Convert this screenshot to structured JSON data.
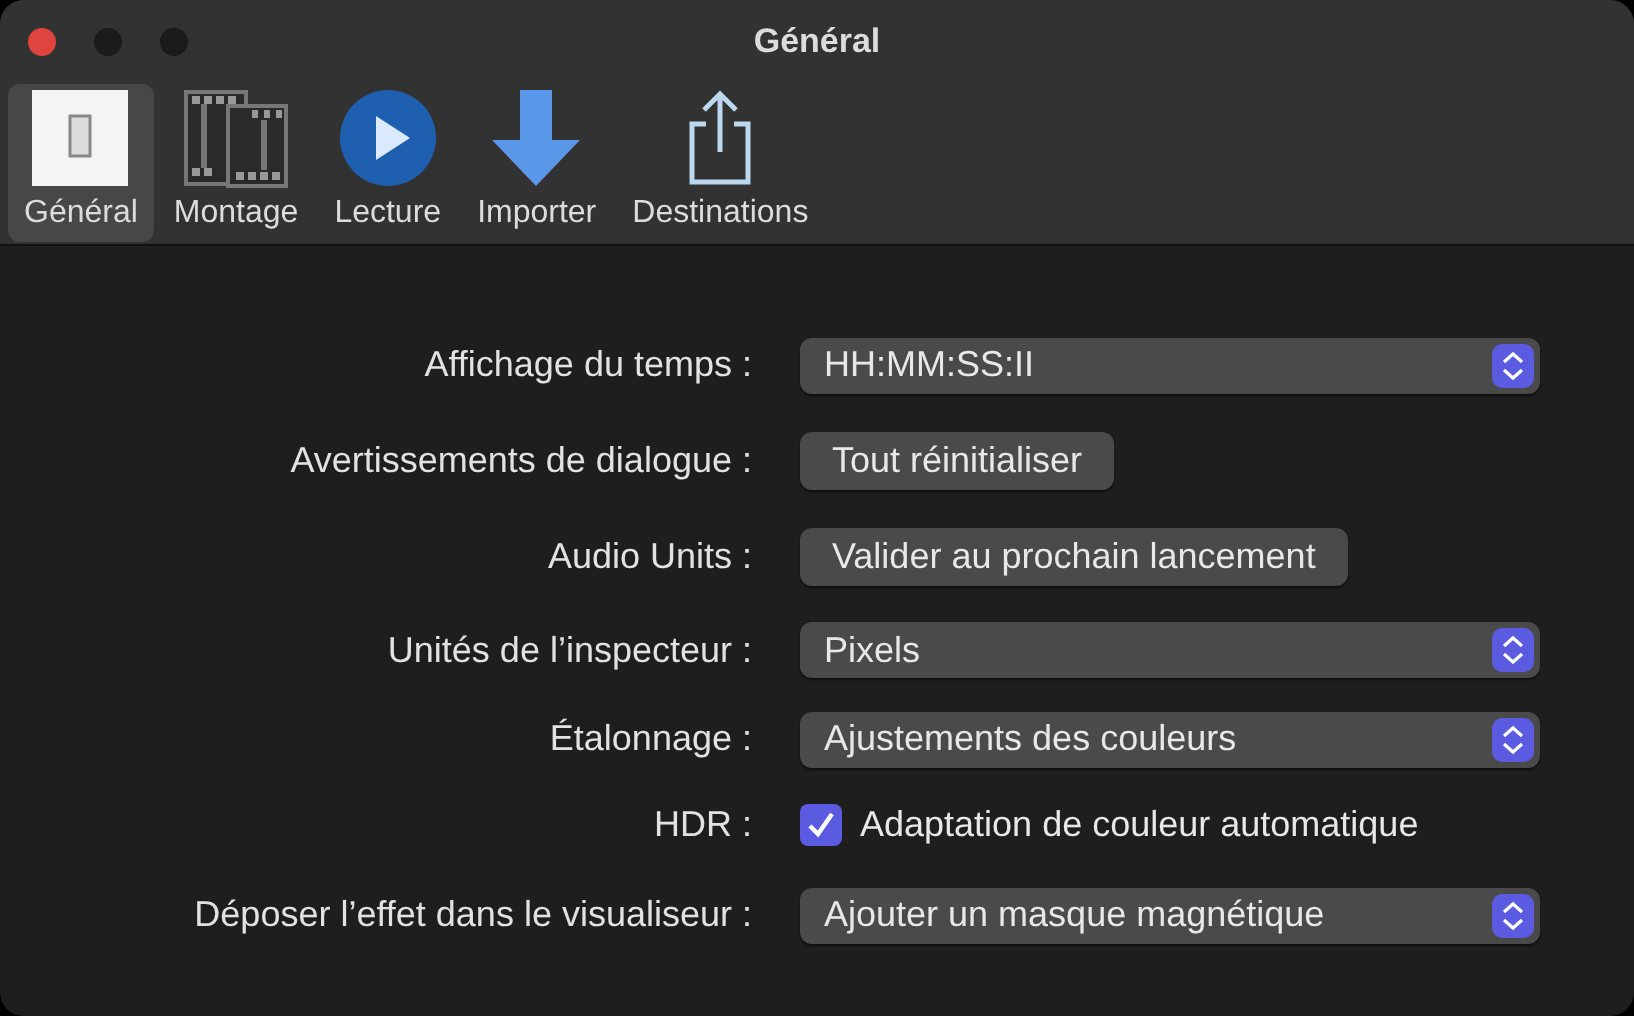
{
  "window": {
    "title": "Général"
  },
  "toolbar": [
    {
      "label": "Général",
      "kind": "switch",
      "selected": true
    },
    {
      "label": "Montage",
      "kind": "film",
      "selected": false
    },
    {
      "label": "Lecture",
      "kind": "play",
      "selected": false
    },
    {
      "label": "Importer",
      "kind": "download",
      "selected": false
    },
    {
      "label": "Destinations",
      "kind": "share",
      "selected": false
    }
  ],
  "settings": [
    {
      "label": "Affichage du temps :",
      "kind": "popup",
      "value": "HH:MM:SS:II"
    },
    {
      "label": "Avertissements de dialogue :",
      "kind": "button",
      "value": "Tout réinitialiser"
    },
    {
      "label": "Audio Units :",
      "kind": "button",
      "value": "Valider au prochain lancement"
    },
    {
      "label": "Unités de l’inspecteur :",
      "kind": "popup",
      "value": "Pixels"
    },
    {
      "label": "Étalonnage :",
      "kind": "popup",
      "value": "Ajustements des couleurs"
    },
    {
      "label": "HDR :",
      "kind": "checkbox",
      "value": "Adaptation de couleur automatique",
      "checked": true
    },
    {
      "label": "Déposer l’effet dans le visualiseur :",
      "kind": "popup",
      "value": "Ajouter un masque magnétique"
    }
  ]
}
